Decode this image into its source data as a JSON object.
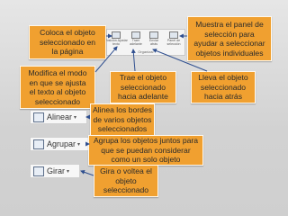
{
  "colors": {
    "callout_bg": "#f0a030",
    "arrow": "#2f4f8f"
  },
  "callouts": {
    "coloca": [
      "Coloca el objeto",
      "seleccionado en",
      "la página"
    ],
    "panel": [
      "Muestra el panel de",
      "selección para",
      "ayudar a seleccionar",
      "objetos individuales"
    ],
    "modifica": [
      "Modifica el modo",
      "en que se ajusta",
      "el texto al objeto",
      "seleccionado"
    ],
    "trae": [
      "Trae el objeto",
      "seleccionado",
      "hacia adelante"
    ],
    "lleva": [
      "Lleva el objeto",
      "seleccionado",
      "hacia atrás"
    ],
    "alinea": [
      "Alinea los bordes",
      "de varios objetos",
      "seleccionados"
    ],
    "agrupa": [
      "Agrupa los objetos juntos para",
      "que se puedan considerar",
      "como un solo objeto"
    ],
    "gira": [
      "Gira o voltea el",
      "objeto",
      "seleccionado"
    ]
  },
  "ribbon": {
    "items": [
      {
        "label": "Posición Ajustar",
        "label2": "texto"
      },
      {
        "label": "Traer",
        "label2": "adelante"
      },
      {
        "label": "Enviar",
        "label2": "atrás"
      },
      {
        "label": "Panel de",
        "label2": "selección"
      }
    ],
    "group_label": "Organizar"
  },
  "side_buttons": {
    "alinear": {
      "label": "Alinear",
      "icon": "align-icon"
    },
    "agrupar": {
      "label": "Agrupar",
      "icon": "group-icon"
    },
    "girar": {
      "label": "Girar",
      "icon": "rotate-icon"
    }
  }
}
